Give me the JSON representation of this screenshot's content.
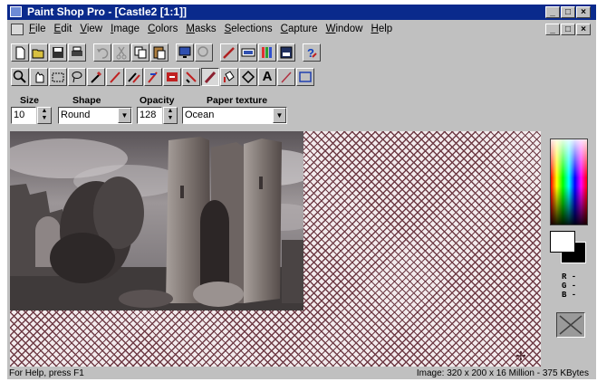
{
  "window": {
    "title": "Paint Shop Pro - [Castle2 [1:1]]",
    "buttons": [
      "_",
      "□",
      "×"
    ]
  },
  "menu": [
    "File",
    "Edit",
    "View",
    "Image",
    "Colors",
    "Masks",
    "Selections",
    "Capture",
    "Window",
    "Help"
  ],
  "toolbar_main": {
    "icons": [
      "new-icon",
      "open-icon",
      "save-icon",
      "print-icon",
      "undo-icon",
      "cut-icon",
      "copy-icon",
      "paste-icon",
      "full-screen-icon",
      "zoom-icon",
      "paint-toolbox-icon",
      "histogram-icon",
      "palette-icon",
      "color-icon",
      "help-icon"
    ]
  },
  "toolbar_tools": {
    "icons": [
      "zoom-tool-icon",
      "move-tool-icon",
      "selection-tool-icon",
      "lasso-tool-icon",
      "dropper-tool-icon",
      "paintbrush-tool-icon",
      "clone-brush-icon",
      "color-replacer-icon",
      "retouch-icon",
      "eraser-icon",
      "picture-tube-icon",
      "flood-fill-icon",
      "shape-icon",
      "text-icon",
      "line-icon",
      "rectangle-icon"
    ],
    "text_tool_glyph": "A"
  },
  "options": {
    "size_label": "Size",
    "size_value": "10",
    "shape_label": "Shape",
    "shape_value": "Round",
    "opacity_label": "Opacity",
    "opacity_value": "128",
    "texture_label": "Paper texture",
    "texture_value": "Ocean"
  },
  "palette": {
    "r_label": "R -",
    "g_label": "G -",
    "b_label": "B -",
    "foreground_color": "#ffffff",
    "background_color": "#000000"
  },
  "status": {
    "left": "For Help, press F1",
    "right": "Image:  320 x 200 x 16 Million - 375 KBytes"
  },
  "colors": {
    "titlebar": "#0a2a8c",
    "chrome": "#c0c0c0",
    "checker": "#6e3b45"
  }
}
